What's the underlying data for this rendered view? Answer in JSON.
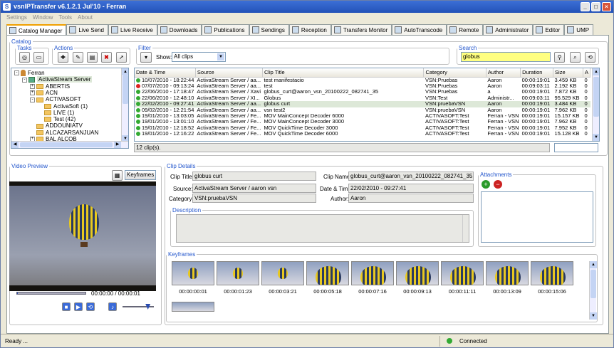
{
  "window": {
    "title": "vsnIPTransfer v6.1.2.1 Jul'10 - Ferran"
  },
  "menu": [
    "Settings",
    "Window",
    "Tools",
    "About"
  ],
  "tabs": [
    {
      "label": "Catalog Manager",
      "active": true
    },
    {
      "label": "Live Send"
    },
    {
      "label": "Live Receive"
    },
    {
      "label": "Downloads"
    },
    {
      "label": "Publications"
    },
    {
      "label": "Sendings"
    },
    {
      "label": "Reception"
    },
    {
      "label": "Transfers Monitor"
    },
    {
      "label": "AutoTranscode"
    },
    {
      "label": "Remote"
    },
    {
      "label": "Administrator"
    },
    {
      "label": "Editor"
    },
    {
      "label": "UMP"
    }
  ],
  "catalog": {
    "legend": "Catalog",
    "tasks_legend": "Tasks",
    "actions_legend": "Actions",
    "filter_legend": "Filter",
    "show_label": "Show:",
    "show_value": "All clips",
    "search_legend": "Search",
    "search_value": "globus",
    "clip_count": "12 clip(s)."
  },
  "tree": [
    {
      "label": "Ferran",
      "level": 0,
      "type": "user",
      "expander": "-"
    },
    {
      "label": "ActivaStream Server",
      "level": 1,
      "type": "server",
      "expander": "-",
      "selected": true
    },
    {
      "label": "ABERTIS",
      "level": 2,
      "type": "folder",
      "expander": "+"
    },
    {
      "label": "ACN",
      "level": 2,
      "type": "folder",
      "expander": "+"
    },
    {
      "label": "ACTIVASOFT",
      "level": 2,
      "type": "folder",
      "expander": "-"
    },
    {
      "label": "ActivaSoft (1)",
      "level": 3,
      "type": "folder"
    },
    {
      "label": "LIVE (1)",
      "level": 3,
      "type": "folder"
    },
    {
      "label": "Test (42)",
      "level": 3,
      "type": "folder"
    },
    {
      "label": "ADDOUNIATV",
      "level": 2,
      "type": "folder"
    },
    {
      "label": "ALCAZARSANJUAN",
      "level": 2,
      "type": "folder"
    },
    {
      "label": "BAL ALCOB",
      "level": 2,
      "type": "folder",
      "expander": "+"
    }
  ],
  "grid": {
    "columns": [
      "Date & Time",
      "Source",
      "Clip Title",
      "Category",
      "Author",
      "Duration",
      "Size",
      "A"
    ],
    "rows": [
      {
        "status": "ok",
        "cells": [
          "10/07/2010 - 18:22:44",
          "ActivaStream Server / aa...",
          "test manifestacio",
          "VSN:Pruebas",
          "Aaron",
          "00:00:19:01",
          "3.459 KB",
          "0"
        ]
      },
      {
        "status": "err",
        "cells": [
          "07/07/2010 - 09:13:24",
          "ActivaStream Server / aa...",
          "test",
          "VSN:Pruebas",
          "Aaron",
          "00:09:03:11",
          "2.192 KB",
          "0"
        ]
      },
      {
        "status": "ok",
        "cells": [
          "22/06/2010 - 17:18:47",
          "ActivaStream Server / Xavi",
          "globus_curt@aaron_vsn_20100222_082741_35",
          "VSN:Pruebas",
          "a",
          "00:00:19:01",
          "7.872 KB",
          "0"
        ]
      },
      {
        "status": "ok",
        "cells": [
          "22/06/2010 - 12:48:10",
          "ActivaStream Server / XI...",
          "Globus",
          "VSN:Test",
          "Administr...",
          "00:09:03:11",
          "95.529 KB",
          "0"
        ]
      },
      {
        "status": "ok",
        "selected": true,
        "cells": [
          "22/02/2010 - 09:27:41",
          "ActivaStream Server / aa...",
          "globus curt",
          "VSN:pruebaVSN",
          "Aaron",
          "00:00:19:01",
          "3.484 KB",
          "0"
        ]
      },
      {
        "status": "ok",
        "cells": [
          "09/02/2010 - 12:21:54",
          "ActivaStream Server / aa...",
          "vsn test2",
          "VSN:pruebaVSN",
          "Aaron",
          "00:00:19:01",
          "7.962 KB",
          "0"
        ]
      },
      {
        "status": "ok",
        "cells": [
          "19/01/2010 - 13:03:05",
          "ActivaStream Server / Fe...",
          "MOV MainConcept Decoder 6000",
          "ACTIVASOFT:Test",
          "Ferran - VSN",
          "00:00:19:01",
          "15.157 KB",
          "0"
        ]
      },
      {
        "status": "ok",
        "cells": [
          "19/01/2010 - 13:01:10",
          "ActivaStream Server / Fe...",
          "MOV MainConcept Decoder 3000",
          "ACTIVASOFT:Test",
          "Ferran - VSN",
          "00:00:19:01",
          "7.962 KB",
          "0"
        ]
      },
      {
        "status": "ok",
        "cells": [
          "19/01/2010 - 12:18:52",
          "ActivaStream Server / Fe...",
          "MOV QuickTime Decoder 3000",
          "ACTIVASOFT:Test",
          "Ferran - VSN",
          "00:00:19:01",
          "7.952 KB",
          "0"
        ]
      },
      {
        "status": "ok",
        "cells": [
          "19/01/2010 - 12:16:22",
          "ActivaStream Server / Fe...",
          "MOV QuickTime Decoder 6000",
          "ACTIVASOFT:Test",
          "Ferran - VSN",
          "00:00:19:01",
          "15.128 KB",
          "0"
        ]
      }
    ]
  },
  "preview": {
    "legend": "Video Preview",
    "keyframes_button": "Keyframes",
    "timecode": "00:00:00 / 00:00:01",
    "playback_progress": 0.01,
    "volume_level": 0.8
  },
  "details": {
    "legend": "Clip Details",
    "clip_title_label": "Clip Title:",
    "clip_title": "globus curt",
    "source_label": "Source:",
    "source": "ActivaStream Server / aaron vsn",
    "category_label": "Category:",
    "category": "VSN:pruebaVSN",
    "clip_name_label": "Clip Name:",
    "clip_name": "globus_curt@aaron_vsn_20100222_082741_35",
    "datetime_label": "Date & Time:",
    "datetime": "22/02/2010 - 09:27:41",
    "author_label": "Author:",
    "author": "Aaron",
    "description_legend": "Description",
    "attachments_legend": "Attachments",
    "keyframes_legend": "Keyframes"
  },
  "keyframes": [
    "00:00:00:01",
    "00:00:01:23",
    "00:00:03:21",
    "00:00:05:18",
    "00:00:07:16",
    "00:00:09:13",
    "00:00:11:11",
    "00:00:13:09",
    "00:00:15:06"
  ],
  "status": {
    "left": "Ready ...",
    "connection": "Connected"
  }
}
